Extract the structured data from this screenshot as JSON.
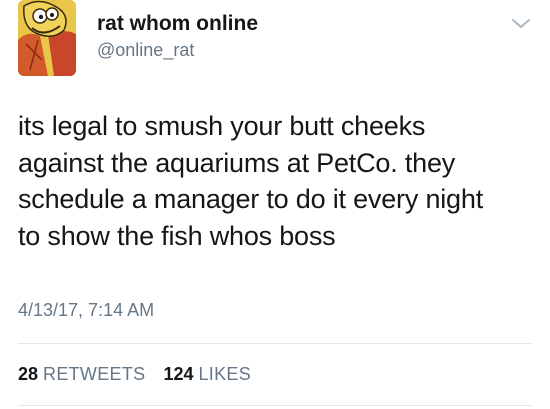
{
  "author": {
    "display_name": "rat whom online",
    "handle": "@online_rat",
    "avatar_icon": "cartoon-rat-avatar-icon"
  },
  "menu": {
    "icon": "chevron-down-icon"
  },
  "tweet": {
    "lines": [
      "its legal to smush your butt cheeks",
      "against the aquariums at PetCo. they",
      "schedule a manager to do it every night",
      "to show the fish whos boss"
    ],
    "timestamp": "4/13/17, 7:14 AM"
  },
  "stats": {
    "retweets": {
      "count": "28",
      "label": "RETWEETS"
    },
    "likes": {
      "count": "124",
      "label": "LIKES"
    }
  },
  "colors": {
    "text": "#14171a",
    "secondary": "#657786",
    "divider": "#e1e8ed",
    "avatar_bg": "#e8c64a"
  }
}
